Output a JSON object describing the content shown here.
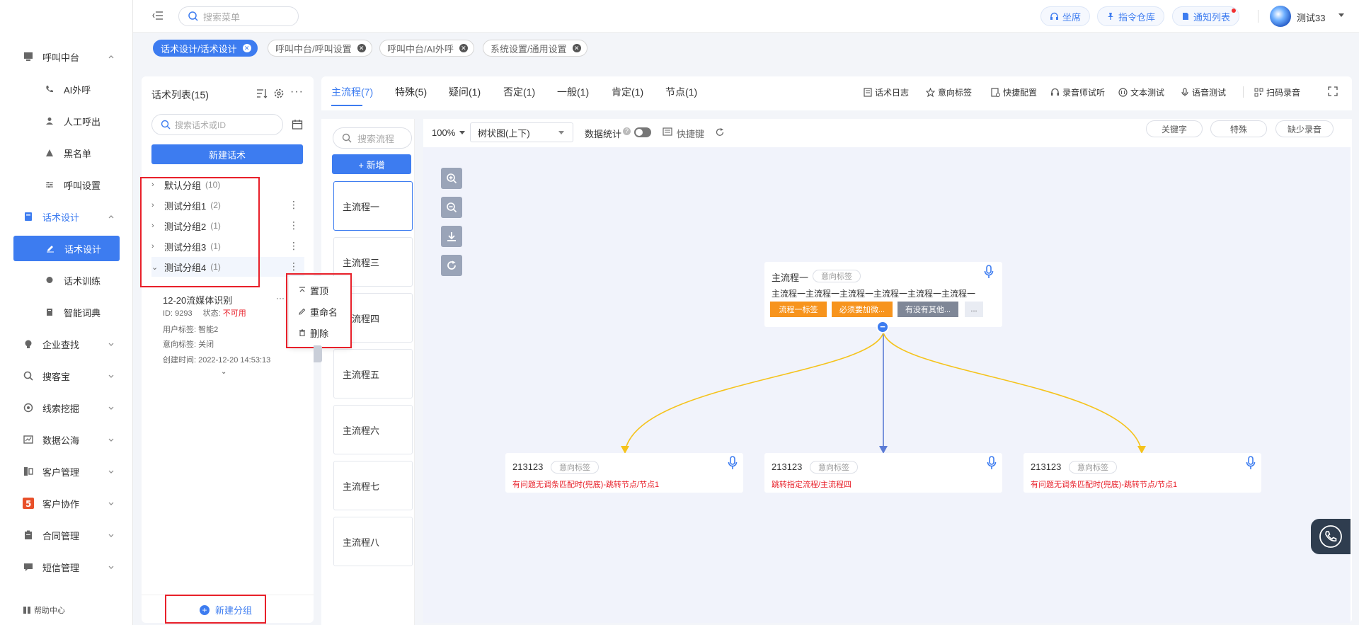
{
  "sidebar": {
    "items": [
      {
        "label": "呼叫中台",
        "icon": "monitor-icon"
      },
      {
        "label": "AI外呼",
        "icon": "phone-icon"
      },
      {
        "label": "人工呼出",
        "icon": "person-icon"
      },
      {
        "label": "黑名单",
        "icon": "warning-icon"
      },
      {
        "label": "呼叫设置",
        "icon": "sliders-icon"
      },
      {
        "label": "话术设计",
        "icon": "book-icon"
      },
      {
        "label": "话术设计",
        "icon": "edit-icon"
      },
      {
        "label": "话术训练",
        "icon": "chat-icon"
      },
      {
        "label": "智能词典",
        "icon": "dictionary-icon"
      },
      {
        "label": "企业查找",
        "icon": "bulb-icon"
      },
      {
        "label": "搜客宝",
        "icon": "search-icon"
      },
      {
        "label": "线索挖掘",
        "icon": "target-icon"
      },
      {
        "label": "数据公海",
        "icon": "chart-icon"
      },
      {
        "label": "客户管理",
        "icon": "customer-icon"
      },
      {
        "label": "客户协作",
        "icon": "team-icon"
      },
      {
        "label": "合同管理",
        "icon": "clipboard-icon"
      },
      {
        "label": "短信管理",
        "icon": "message-icon"
      }
    ],
    "help": "帮助中心"
  },
  "topbar": {
    "search_placeholder": "搜索菜单",
    "seat": "坐席",
    "command_repo": "指令仓库",
    "notice_list": "通知列表",
    "user": "测试33"
  },
  "tags": [
    {
      "label": "话术设计/话术设计",
      "active": true
    },
    {
      "label": "呼叫中台/呼叫设置",
      "active": false
    },
    {
      "label": "呼叫中台/AI外呼",
      "active": false
    },
    {
      "label": "系统设置/通用设置",
      "active": false
    }
  ],
  "left_panel": {
    "title": "话术列表(15)",
    "search_placeholder": "搜索话术或ID",
    "new_script": "新建话术",
    "groups": [
      {
        "name": "默认分组",
        "count": "(10)"
      },
      {
        "name": "测试分组1",
        "count": "(2)"
      },
      {
        "name": "测试分组2",
        "count": "(1)"
      },
      {
        "name": "测试分组3",
        "count": "(1)"
      },
      {
        "name": "测试分组4",
        "count": "(1)"
      }
    ],
    "script": {
      "name": "12-20流媒体识别",
      "id_label": "ID:",
      "id": "9293",
      "status_label": "状态:",
      "status": "不可用",
      "user_tag": "用户标签:  智能2",
      "intent_tag": "意向标签:  关闭",
      "created": "创建时间:  2022-12-20 14:53:13"
    },
    "new_group": "新建分组"
  },
  "context_menu": {
    "items": [
      "置顶",
      "重命名",
      "删除"
    ]
  },
  "main": {
    "tabs": [
      "主流程(7)",
      "特殊(5)",
      "疑问(1)",
      "否定(1)",
      "一般(1)",
      "肯定(1)",
      "节点(1)"
    ],
    "tools": [
      "话术日志",
      "意向标签",
      "快捷配置",
      "录音师试听",
      "文本测试",
      "语音测试",
      "扫码录音"
    ],
    "flow_search_placeholder": "搜索流程",
    "add_flow": "+ 新增",
    "flows": [
      "主流程一",
      "主流程三",
      "主流程四",
      "主流程五",
      "主流程六",
      "主流程七",
      "主流程八"
    ],
    "zoom": "100%",
    "view_mode": "树状图(上下)",
    "stats_label": "数据统计",
    "shortcut": "快捷键",
    "pills": [
      "关键字",
      "特殊",
      "缺少录音"
    ]
  },
  "graph": {
    "root": {
      "title": "主流程一",
      "tag": "意向标签",
      "text": "主流程一主流程一主流程一主流程一主流程一主流程一",
      "buttons": [
        "流程一标签",
        "必须要加微...",
        "有没有其他...",
        "..."
      ]
    },
    "children": [
      {
        "title": "213123",
        "tag": "意向标签",
        "text": "有问题无调条匹配时(兜底)-跳转节点/节点1"
      },
      {
        "title": "213123",
        "tag": "意向标签",
        "text": "跳转指定流程/主流程四"
      },
      {
        "title": "213123",
        "tag": "意向标签",
        "text": "有问题无调条匹配时(兜底)-跳转节点/节点1"
      }
    ]
  },
  "colors": {
    "primary": "#3d7cf0",
    "orange": "#f7941d",
    "gray_btn": "#7f8797",
    "danger": "#e8202a",
    "curve": "#f5c31c"
  }
}
